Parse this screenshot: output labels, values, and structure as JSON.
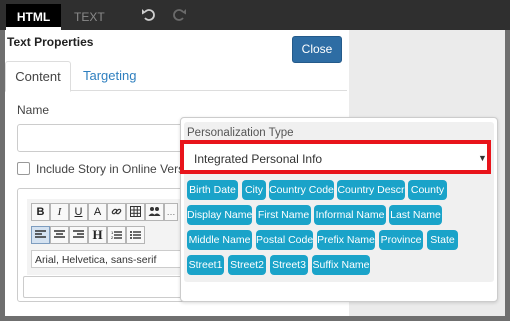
{
  "topbar": {
    "tab_html": "HTML",
    "tab_text": "TEXT"
  },
  "header": {
    "title": "Text Properties",
    "close_label": "Close"
  },
  "tabs": {
    "content": "Content",
    "targeting": "Targeting"
  },
  "form": {
    "name_label": "Name",
    "name_value": "",
    "include_story_label": "Include Story in Online Version",
    "include_story_checked": false
  },
  "editor": {
    "font_family": "Arial, Helvetica, sans-serif",
    "toolbar_row1": [
      "B",
      "I",
      "U",
      "A",
      "link",
      "table",
      "users",
      "more"
    ],
    "toolbar_row2": [
      "align-left",
      "align-center",
      "align-right",
      "H",
      "ordered-list",
      "unordered-list"
    ]
  },
  "personalization": {
    "type_label": "Personalization Type",
    "type_value": "Integrated Personal Info",
    "highlight_color": "#e8141b",
    "chip_color": "#1aa3c9",
    "fields": [
      [
        "Birth Date",
        "City",
        "Country Code",
        "Country Descr",
        "County"
      ],
      [
        "Display Name",
        "First Name",
        "Informal Name",
        "Last Name"
      ],
      [
        "Middle Name",
        "Postal Code",
        "Prefix Name",
        "Province",
        "State"
      ],
      [
        "Street1",
        "Street2",
        "Street3",
        "Suffix Name"
      ]
    ]
  }
}
